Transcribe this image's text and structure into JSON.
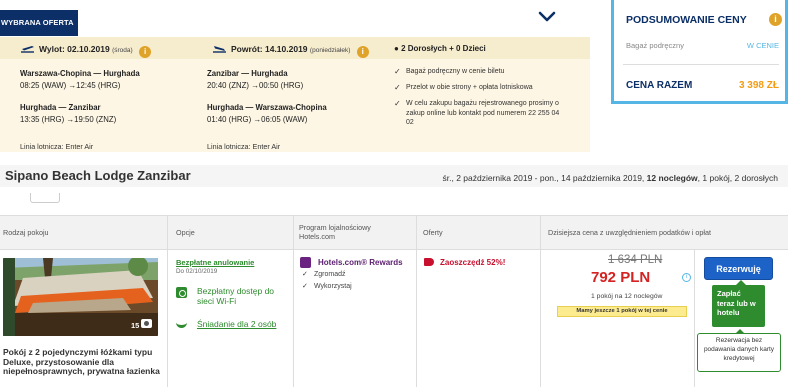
{
  "offer": {
    "badge": "WYBRANA OFERTA",
    "outbound": {
      "title": "Wylot: 02.10.2019",
      "weekday": "(środa)",
      "seg1_route": "Warszawa-Chopina — Hurghada",
      "seg1_time": "08:25 (WAW) →12:45 (HRG)",
      "seg2_route": "Hurghada — Zanzibar",
      "seg2_time": "13:35 (HRG) →19:50 (ZNZ)",
      "airline": "Linia lotnicza: Enter Air"
    },
    "return": {
      "title": "Powrót: 14.10.2019",
      "weekday": "(poniedziałek)",
      "seg1_route": "Zanzibar — Hurghada",
      "seg1_time": "20:40 (ZNZ) →00:50 (HRG)",
      "seg2_route": "Hurghada — Warszawa-Chopina",
      "seg2_time": "01:40 (HRG) →06:05 (WAW)",
      "airline": "Linia lotnicza: Enter Air"
    },
    "passengers": "2 Dorosłych + 0 Dzieci",
    "included": [
      "Bagaż podręczny w cenie biletu",
      "Przelot w obie strony + opłata lotniskowa",
      "W celu zakupu bagażu rejestrowanego prosimy o zakup online lub kontakt pod numerem 22 255 04 02"
    ],
    "info_symbol": "i"
  },
  "summary": {
    "title": "PODSUMOWANIE CENY",
    "info_symbol": "i",
    "baggage_label": "Bagaż podręczny",
    "baggage_value": "W CENIE",
    "total_label": "CENA RAZEM",
    "total_value": "3 398 ZŁ"
  },
  "hotel": {
    "name": "Sipano Beach Lodge Zanzibar",
    "dates_prefix": "śr., 2 października 2019 - pon., 14 października 2019, ",
    "nights": "12 noclegów",
    "dates_suffix": ", 1 pokój, 2 dorosłych"
  },
  "table": {
    "headers": {
      "room_type": "Rodzaj pokoju",
      "options": "Opcje",
      "loyalty": "Program lojalnościowy Hotels.com",
      "offers": "Oferty",
      "price": "Dzisiejsza cena z uwzględnieniem podatków i opłat"
    },
    "room": {
      "photo_count": "15",
      "name": "Pokój z 2 pojedynczymi łóżkami typu Deluxe, przystosowanie dla niepełnosprawnych, prywatna łazienka",
      "free_cancel": "Bezpłatne anulowanie",
      "cancel_date": "Do 02/10/2019",
      "wifi": "Bezpłatny dostęp do sieci Wi-Fi",
      "breakfast": "Śniadanie dla 2 osób",
      "loyalty_title": "Hotels.com® Rewards",
      "loyalty_items": [
        "Zgromadź",
        "Wykorzystaj"
      ],
      "deal": "Zaoszczędź 52%!",
      "old_price": "1 634 PLN",
      "new_price": "792 PLN",
      "price_info_symbol": "i",
      "per_night": "1 pokój na 12 noclegów",
      "last_room": "Mamy jeszcze 1 pokój w tej cenie",
      "book_button": "Rezerwuję",
      "pay_box": "Zapłać teraz lub w hotelu",
      "pay_note": "Rezerwacja bez podawania danych karty kredytowej"
    }
  },
  "colors": {
    "navy": "#0b2f66",
    "accent_blue": "#55b6e6",
    "orange": "#f39c12",
    "green": "#2e8b2e",
    "red": "#d32323",
    "book_blue": "#1d63c7"
  }
}
